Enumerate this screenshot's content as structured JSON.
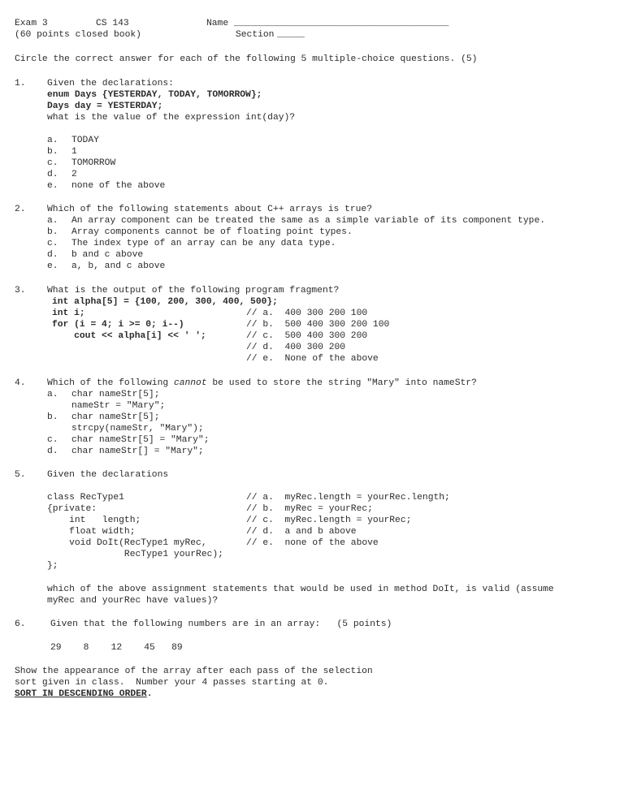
{
  "header": {
    "exam_label": "Exam 3",
    "course": "CS 143",
    "name_label": "Name",
    "name_rule": "_______________________________________",
    "points_note": "(60 points closed book)",
    "section_label": "Section",
    "section_rule": "_____"
  },
  "instructions": "Circle the correct answer for each of the following 5 multiple-choice questions. (5)",
  "questions": [
    {
      "number": "1.",
      "stem": "Given the declarations:",
      "code": [
        "enum Days {YESTERDAY, TODAY, TOMORROW};",
        "Days day = YESTERDAY;"
      ],
      "stem2": "what is the value of the expression int(day)?",
      "choices": [
        {
          "letter": "a.",
          "text": "TODAY"
        },
        {
          "letter": "b.",
          "text": "1"
        },
        {
          "letter": "c.",
          "text": "TOMORROW"
        },
        {
          "letter": "d.",
          "text": "2"
        },
        {
          "letter": "e.",
          "text": "none of the above"
        }
      ]
    },
    {
      "number": "2.",
      "stem": "Which of the following statements about C++ arrays is true?",
      "choices": [
        {
          "letter": "a.",
          "text": "An array component can be treated the same as a simple variable of its component type."
        },
        {
          "letter": "b.",
          "text": "Array components cannot be of floating point types."
        },
        {
          "letter": "c.",
          "text": "The index type of an array can be any data type."
        },
        {
          "letter": "d.",
          "text": "b and c above"
        },
        {
          "letter": "e.",
          "text": "a, b, and c above"
        }
      ]
    },
    {
      "number": "3.",
      "stem": "What is the output of the following program fragment?",
      "code": [
        "int alpha[5] = {100, 200, 300, 400, 500};",
        "int i;",
        "for (i = 4; i >= 0; i--)",
        "    cout << alpha[i] << ' ';"
      ],
      "comments": [
        "// a.  400 300 200 100",
        "// b.  500 400 300 200 100",
        "// c.  500 400 300 200",
        "// d.  400 300 200",
        "// e.  None of the above"
      ]
    },
    {
      "number": "4.",
      "stem_pre": "Which of the following ",
      "stem_em": "cannot",
      "stem_post": " be used to store the string \"Mary\" into nameStr?",
      "choices": [
        {
          "letter": "a.",
          "text": "char nameStr[5];"
        },
        {
          "letter": "",
          "text": "nameStr = \"Mary\";"
        },
        {
          "letter": "b.",
          "text": "char nameStr[5];"
        },
        {
          "letter": "",
          "text": "strcpy(nameStr, \"Mary\");"
        },
        {
          "letter": "c.",
          "text": "char nameStr[5] = \"Mary\";"
        },
        {
          "letter": "d.",
          "text": "char nameStr[] = \"Mary\";"
        }
      ]
    },
    {
      "number": "5.",
      "stem": "Given the declarations",
      "code": [
        "class RecType1",
        "{private:",
        "    int   length;",
        "    float width;",
        "    void DoIt(RecType1 myRec,",
        "              RecType1 yourRec);",
        "};"
      ],
      "comments": [
        "// a.  myRec.length = yourRec.length;",
        "// b.  myRec = yourRec;",
        "// c.  myRec.length = yourRec;",
        "// d.  a and b above",
        "// e.  none of the above"
      ],
      "tail_line1": "which of the above assignment statements that would be used in method DoIt, is valid (assume",
      "tail_line2": "myRec and yourRec have values)?"
    },
    {
      "number": "6.",
      "stem": "Given that the following numbers are in an array:   (5 points)",
      "array_values": "29    8    12    45   89",
      "instr_line1": "Show the appearance of the array after each pass of the selection",
      "instr_line2": "sort given in class.  Number your 4 passes starting at 0.",
      "directive": "SORT IN DESCENDING ORDER",
      "directive_period": "."
    }
  ]
}
